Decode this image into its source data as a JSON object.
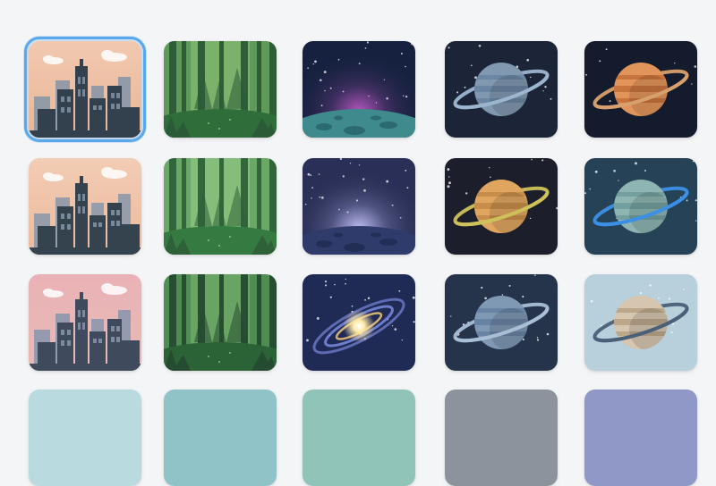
{
  "gallery": {
    "selected_index": 0,
    "rows": [
      [
        {
          "kind": "city",
          "sky_top": "#f1c9b0",
          "sky_bottom": "#e9b596",
          "build_far": "#8a97a8",
          "build_near": "#33414f",
          "window": "#7d8ea2",
          "icon": "city-skyline-icon"
        },
        {
          "kind": "forest",
          "bg": "#5f9a5a",
          "light": "#8fc57a",
          "trunk": "#2b5a37",
          "floor": "#2f6e3a",
          "icon": "forest-icon"
        },
        {
          "kind": "moon",
          "sky": "#16213f",
          "glow": "#c05bc8",
          "surface": "#3f8a8c",
          "crater": "#2b6a6f",
          "icon": "moon-horizon-icon"
        },
        {
          "kind": "planet",
          "bg": "#1c2438",
          "body": "#8098b0",
          "band": "#6b86a3",
          "ring": "#9db6cf",
          "icon": "ringed-planet-icon"
        },
        {
          "kind": "planet",
          "bg": "#141b2c",
          "body": "#e2955a",
          "band": "#c9743e",
          "ring": "#d8a06c",
          "icon": "ringed-planet-icon"
        }
      ],
      [
        {
          "kind": "city",
          "sky_top": "#f2ccb4",
          "sky_bottom": "#ebba9c",
          "build_far": "#8d99aa",
          "build_near": "#35434f",
          "window": "#8092a5",
          "icon": "city-skyline-icon"
        },
        {
          "kind": "forest",
          "bg": "#6aa868",
          "light": "#9bd08a",
          "trunk": "#2f6139",
          "floor": "#357a41",
          "icon": "forest-icon"
        },
        {
          "kind": "moon",
          "sky": "#2a2f57",
          "glow": "#c7c7ff",
          "surface": "#2f3b6a",
          "crater": "#232e56",
          "icon": "moon-horizon-icon"
        },
        {
          "kind": "planet",
          "bg": "#1c1f2b",
          "body": "#e0a660",
          "band": "#c78d4a",
          "ring": "#cfc15a",
          "icon": "ringed-planet-icon"
        },
        {
          "kind": "planet",
          "bg": "#254257",
          "body": "#8eb5b2",
          "band": "#73a09e",
          "ring": "#3c8fe6",
          "icon": "ringed-planet-icon"
        }
      ],
      [
        {
          "kind": "city",
          "sky_top": "#eab2b6",
          "sky_bottom": "#e7b9b4",
          "build_far": "#8d97ad",
          "build_near": "#3f4a5d",
          "window": "#8391a6",
          "icon": "city-skyline-icon"
        },
        {
          "kind": "forest",
          "bg": "#4f8d53",
          "light": "#7fb872",
          "trunk": "#254b30",
          "floor": "#2b6236",
          "icon": "forest-icon"
        },
        {
          "kind": "galaxy",
          "sky": "#1f2a55",
          "core": "#ffe9a6",
          "arm": "#8ea0ff",
          "icon": "galaxy-icon"
        },
        {
          "kind": "planet",
          "bg": "#25344a",
          "body": "#7f98b4",
          "band": "#6883a3",
          "ring": "#a8bfd6",
          "icon": "ringed-planet-icon"
        },
        {
          "kind": "planet",
          "bg": "#b7d0dc",
          "body": "#d6c6b0",
          "band": "#bca78b",
          "ring": "#4a5f78",
          "icon": "ringed-planet-icon"
        }
      ],
      [
        {
          "kind": "partial",
          "bg": "#b9dbe0",
          "icon": "thumbnail-placeholder-icon"
        },
        {
          "kind": "partial",
          "bg": "#8fc3c7",
          "icon": "thumbnail-placeholder-icon"
        },
        {
          "kind": "partial",
          "bg": "#91c4b8",
          "icon": "thumbnail-placeholder-icon"
        },
        {
          "kind": "partial",
          "bg": "#8c939c",
          "icon": "thumbnail-placeholder-icon"
        },
        {
          "kind": "partial",
          "bg": "#8f98c7",
          "icon": "thumbnail-placeholder-icon"
        }
      ]
    ]
  }
}
